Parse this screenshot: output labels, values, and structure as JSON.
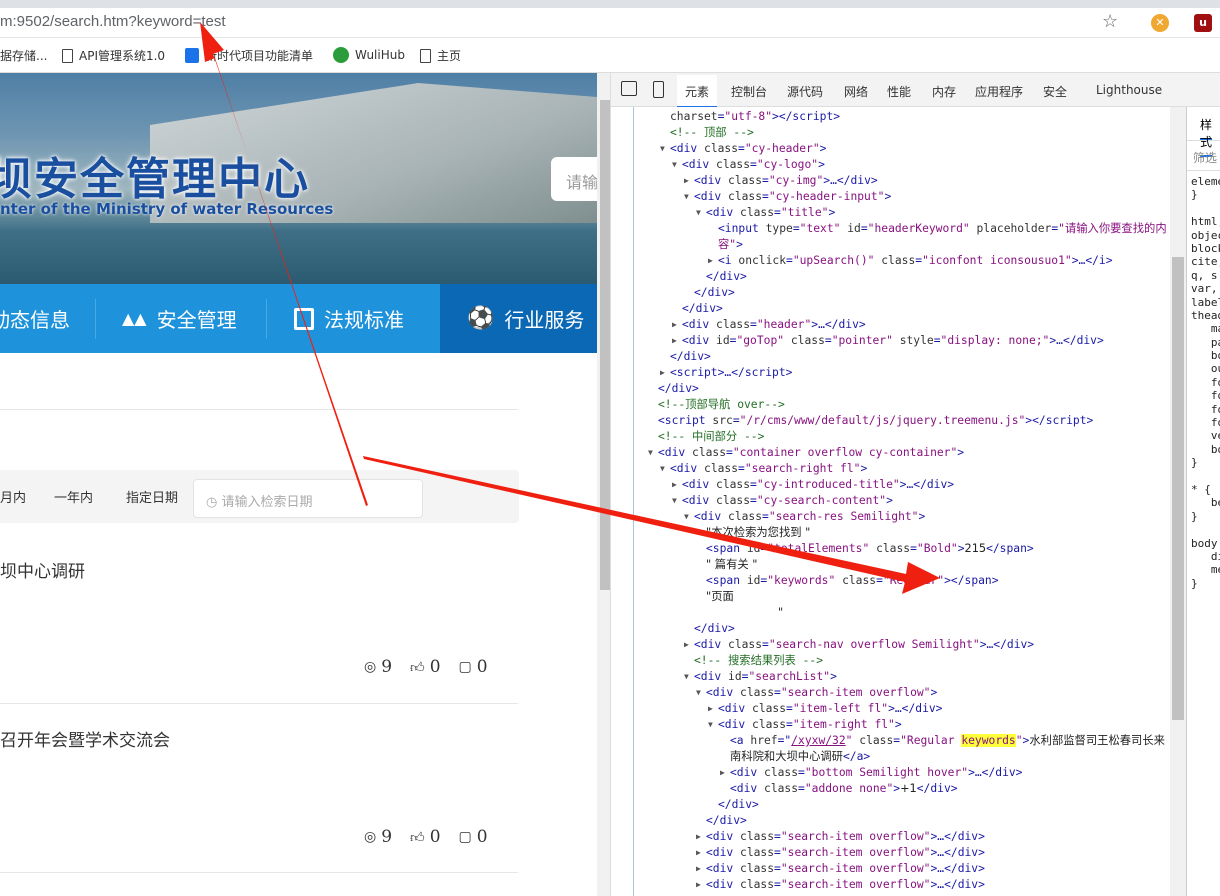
{
  "browser": {
    "url": "m:9502/search.htm?keyword=test",
    "bookmarks": [
      {
        "label": "据存储...",
        "icon": "none"
      },
      {
        "label": "API管理系统1.0",
        "icon": "doc-icon"
      },
      {
        "label": "新时代项目功能清单",
        "icon": "app-icon"
      },
      {
        "label": "WuliHub",
        "icon": "wulihub-icon"
      },
      {
        "label": "主页",
        "icon": "doc-icon"
      }
    ]
  },
  "page": {
    "brand": "坝安全管理中心",
    "brand_sub": "nter of the Ministry of water Resources",
    "header_search_placeholder": "请输",
    "nav": [
      {
        "label": "动态信息"
      },
      {
        "label": "安全管理"
      },
      {
        "label": "法规标准"
      },
      {
        "label": "行业服务"
      }
    ],
    "filters": [
      "月内",
      "一年内",
      "指定日期"
    ],
    "date_placeholder": "请输入检索日期",
    "results": [
      {
        "title": "坝中心调研",
        "views": "9",
        "likes": "0",
        "comments": "0"
      },
      {
        "title": "召开年会暨学术交流会",
        "views": "9",
        "likes": "0",
        "comments": "0"
      }
    ]
  },
  "devtools": {
    "tabs": [
      "元素",
      "控制台",
      "源代码",
      "网络",
      "性能",
      "内存",
      "应用程序",
      "安全",
      "Lighthouse"
    ],
    "active_tab": "元素",
    "lines": [
      {
        "l": 1,
        "s": [
          [
            "a",
            "charset"
          ],
          [
            "t",
            "="
          ],
          [
            "v",
            "\"utf-8\""
          ],
          [
            "t",
            "></script>"
          ]
        ]
      },
      {
        "l": 1,
        "s": [
          [
            "c",
            "<!-- 顶部 -->"
          ]
        ]
      },
      {
        "l": 1,
        "e": "▼",
        "s": [
          [
            "t",
            "<div "
          ],
          [
            "a",
            "class"
          ],
          [
            "t",
            "="
          ],
          [
            "v",
            "\"cy-header\""
          ],
          [
            "t",
            ">"
          ]
        ]
      },
      {
        "l": 2,
        "e": "▼",
        "s": [
          [
            "t",
            "<div "
          ],
          [
            "a",
            "class"
          ],
          [
            "t",
            "="
          ],
          [
            "v",
            "\"cy-logo\""
          ],
          [
            "t",
            ">"
          ]
        ]
      },
      {
        "l": 3,
        "e": "▶",
        "s": [
          [
            "t",
            "<div "
          ],
          [
            "a",
            "class"
          ],
          [
            "t",
            "="
          ],
          [
            "v",
            "\"cy-img\""
          ],
          [
            "t",
            ">…</div>"
          ]
        ]
      },
      {
        "l": 3,
        "e": "▼",
        "s": [
          [
            "t",
            "<div "
          ],
          [
            "a",
            "class"
          ],
          [
            "t",
            "="
          ],
          [
            "v",
            "\"cy-header-input\""
          ],
          [
            "t",
            ">"
          ]
        ]
      },
      {
        "l": 4,
        "e": "▼",
        "s": [
          [
            "t",
            "<div "
          ],
          [
            "a",
            "class"
          ],
          [
            "t",
            "="
          ],
          [
            "v",
            "\"title\""
          ],
          [
            "t",
            ">"
          ]
        ]
      },
      {
        "l": 5,
        "s": [
          [
            "t",
            "<input "
          ],
          [
            "a",
            "type"
          ],
          [
            "t",
            "="
          ],
          [
            "v",
            "\"text\" "
          ],
          [
            "a",
            "id"
          ],
          [
            "t",
            "="
          ],
          [
            "v",
            "\"headerKeyword\" "
          ],
          [
            "a",
            "placeholder"
          ],
          [
            "t",
            "="
          ],
          [
            "v",
            "\"请输入你要查找的内"
          ]
        ]
      },
      {
        "l": 5,
        "s": [
          [
            "v",
            "容\""
          ],
          [
            "t",
            ">"
          ]
        ]
      },
      {
        "l": 5,
        "e": "▶",
        "s": [
          [
            "t",
            "<i "
          ],
          [
            "a",
            "onclick"
          ],
          [
            "t",
            "="
          ],
          [
            "v",
            "\"upSearch()\" "
          ],
          [
            "a",
            "class"
          ],
          [
            "t",
            "="
          ],
          [
            "v",
            "\"iconfont iconsousuo1\""
          ],
          [
            "t",
            ">…</i>"
          ]
        ]
      },
      {
        "l": 4,
        "s": [
          [
            "t",
            "</div>"
          ]
        ]
      },
      {
        "l": 3,
        "s": [
          [
            "t",
            "</div>"
          ]
        ]
      },
      {
        "l": 2,
        "s": [
          [
            "t",
            "</div>"
          ]
        ]
      },
      {
        "l": 2,
        "e": "▶",
        "s": [
          [
            "t",
            "<div "
          ],
          [
            "a",
            "class"
          ],
          [
            "t",
            "="
          ],
          [
            "v",
            "\"header\""
          ],
          [
            "t",
            ">…</div>"
          ]
        ]
      },
      {
        "l": 2,
        "e": "▶",
        "s": [
          [
            "t",
            "<div "
          ],
          [
            "a",
            "id"
          ],
          [
            "t",
            "="
          ],
          [
            "v",
            "\"goTop\" "
          ],
          [
            "a",
            "class"
          ],
          [
            "t",
            "="
          ],
          [
            "v",
            "\"pointer\" "
          ],
          [
            "a",
            "style"
          ],
          [
            "t",
            "="
          ],
          [
            "v",
            "\"display: none;\""
          ],
          [
            "t",
            ">…</div>"
          ]
        ]
      },
      {
        "l": 1,
        "s": [
          [
            "t",
            "</div>"
          ]
        ]
      },
      {
        "l": 1,
        "e": "▶",
        "s": [
          [
            "t",
            "<script>…</script>"
          ]
        ]
      },
      {
        "l": 0,
        "s": [
          [
            "t",
            "</div>"
          ]
        ]
      },
      {
        "l": 0,
        "s": [
          [
            "c",
            "<!--顶部导航 over-->"
          ]
        ]
      },
      {
        "l": 0,
        "s": [
          [
            "t",
            "<script "
          ],
          [
            "a",
            "src"
          ],
          [
            "t",
            "="
          ],
          [
            "v",
            "\"/r/cms/www/default/js/jquery.treemenu.js\""
          ],
          [
            "t",
            "></script>"
          ]
        ]
      },
      {
        "l": 0,
        "s": [
          [
            "c",
            "<!-- 中间部分 -->"
          ]
        ]
      },
      {
        "l": 0,
        "e": "▼",
        "s": [
          [
            "t",
            "<div "
          ],
          [
            "a",
            "class"
          ],
          [
            "t",
            "="
          ],
          [
            "v",
            "\"container overflow cy-container\""
          ],
          [
            "t",
            ">"
          ]
        ]
      },
      {
        "l": 1,
        "e": "▼",
        "s": [
          [
            "t",
            "<div "
          ],
          [
            "a",
            "class"
          ],
          [
            "t",
            "="
          ],
          [
            "v",
            "\"search-right fl\""
          ],
          [
            "t",
            ">"
          ]
        ]
      },
      {
        "l": 2,
        "e": "▶",
        "s": [
          [
            "t",
            "<div "
          ],
          [
            "a",
            "class"
          ],
          [
            "t",
            "="
          ],
          [
            "v",
            "\"cy-introduced-title\""
          ],
          [
            "t",
            ">…</div>"
          ]
        ]
      },
      {
        "l": 2,
        "e": "▼",
        "s": [
          [
            "t",
            "<div "
          ],
          [
            "a",
            "class"
          ],
          [
            "t",
            "="
          ],
          [
            "v",
            "\"cy-search-content\""
          ],
          [
            "t",
            ">"
          ]
        ]
      },
      {
        "l": 3,
        "e": "▼",
        "s": [
          [
            "t",
            "<div "
          ],
          [
            "a",
            "class"
          ],
          [
            "t",
            "="
          ],
          [
            "v",
            "\"search-res Semilight\""
          ],
          [
            "t",
            ">"
          ]
        ]
      },
      {
        "l": 4,
        "s": [
          [
            "x",
            "\"本次检索为您找到 \""
          ]
        ]
      },
      {
        "l": 4,
        "s": [
          [
            "t",
            "<span "
          ],
          [
            "a",
            "id"
          ],
          [
            "t",
            "="
          ],
          [
            "v",
            "\"totalElements\" "
          ],
          [
            "a",
            "class"
          ],
          [
            "t",
            "="
          ],
          [
            "v",
            "\"Bold\""
          ],
          [
            "t",
            ">"
          ],
          [
            "x",
            "215"
          ],
          [
            "t",
            "</span>"
          ]
        ]
      },
      {
        "l": 4,
        "s": [
          [
            "x",
            "\" 篇有关 \""
          ]
        ]
      },
      {
        "l": 4,
        "s": [
          [
            "t",
            "<span "
          ],
          [
            "a",
            "id"
          ],
          [
            "t",
            "="
          ],
          [
            "v",
            "\"keywords\" "
          ],
          [
            "a",
            "class"
          ],
          [
            "t",
            "="
          ],
          [
            "v",
            "\"Regular\""
          ],
          [
            "t",
            "></span>"
          ]
        ]
      },
      {
        "l": 4,
        "s": [
          [
            "x",
            "\"页面"
          ]
        ]
      },
      {
        "l": 10,
        "s": [
          [
            "x",
            "\""
          ]
        ]
      },
      {
        "l": 3,
        "s": [
          [
            "t",
            "</div>"
          ]
        ]
      },
      {
        "l": 3,
        "e": "▶",
        "s": [
          [
            "t",
            "<div "
          ],
          [
            "a",
            "class"
          ],
          [
            "t",
            "="
          ],
          [
            "v",
            "\"search-nav overflow Semilight\""
          ],
          [
            "t",
            ">…</div>"
          ]
        ]
      },
      {
        "l": 3,
        "s": [
          [
            "c",
            "<!-- 搜索结果列表 -->"
          ]
        ]
      },
      {
        "l": 3,
        "e": "▼",
        "s": [
          [
            "t",
            "<div "
          ],
          [
            "a",
            "id"
          ],
          [
            "t",
            "="
          ],
          [
            "v",
            "\"searchList\""
          ],
          [
            "t",
            ">"
          ]
        ]
      },
      {
        "l": 4,
        "e": "▼",
        "s": [
          [
            "t",
            "<div "
          ],
          [
            "a",
            "class"
          ],
          [
            "t",
            "="
          ],
          [
            "v",
            "\"search-item overflow\""
          ],
          [
            "t",
            ">"
          ]
        ]
      },
      {
        "l": 5,
        "e": "▶",
        "s": [
          [
            "t",
            "<div "
          ],
          [
            "a",
            "class"
          ],
          [
            "t",
            "="
          ],
          [
            "v",
            "\"item-left fl\""
          ],
          [
            "t",
            ">…</div>"
          ]
        ]
      },
      {
        "l": 5,
        "e": "▼",
        "s": [
          [
            "t",
            "<div "
          ],
          [
            "a",
            "class"
          ],
          [
            "t",
            "="
          ],
          [
            "v",
            "\"item-right fl\""
          ],
          [
            "t",
            ">"
          ]
        ]
      },
      {
        "l": 6,
        "s": [
          [
            "t",
            "<a "
          ],
          [
            "a",
            "href"
          ],
          [
            "t",
            "=\""
          ],
          [
            "u",
            "/xyxw/32"
          ],
          [
            "v",
            "\" "
          ],
          [
            "a",
            "class"
          ],
          [
            "t",
            "="
          ],
          [
            "v",
            "\"Regular "
          ],
          [
            "h",
            "keywords"
          ],
          [
            "v",
            "\""
          ],
          [
            "t",
            ">"
          ],
          [
            "x",
            "水利部监督司王松春司长来"
          ]
        ]
      },
      {
        "l": 6,
        "s": [
          [
            "x",
            "南科院和大坝中心调研"
          ],
          [
            "t",
            "</a>"
          ]
        ]
      },
      {
        "l": 6,
        "e": "▶",
        "s": [
          [
            "t",
            "<div "
          ],
          [
            "a",
            "class"
          ],
          [
            "t",
            "="
          ],
          [
            "v",
            "\"bottom Semilight hover\""
          ],
          [
            "t",
            ">…</div>"
          ]
        ]
      },
      {
        "l": 6,
        "s": [
          [
            "t",
            "<div "
          ],
          [
            "a",
            "class"
          ],
          [
            "t",
            "="
          ],
          [
            "v",
            "\"addone none\""
          ],
          [
            "t",
            ">"
          ],
          [
            "x",
            "+1"
          ],
          [
            "t",
            "</div>"
          ]
        ]
      },
      {
        "l": 5,
        "s": [
          [
            "t",
            "</div>"
          ]
        ]
      },
      {
        "l": 4,
        "s": [
          [
            "t",
            "</div>"
          ]
        ]
      },
      {
        "l": 4,
        "e": "▶",
        "s": [
          [
            "t",
            "<div "
          ],
          [
            "a",
            "class"
          ],
          [
            "t",
            "="
          ],
          [
            "v",
            "\"search-item overflow\""
          ],
          [
            "t",
            ">…</div>"
          ]
        ]
      },
      {
        "l": 4,
        "e": "▶",
        "s": [
          [
            "t",
            "<div "
          ],
          [
            "a",
            "class"
          ],
          [
            "t",
            "="
          ],
          [
            "v",
            "\"search-item overflow\""
          ],
          [
            "t",
            ">…</div>"
          ]
        ]
      },
      {
        "l": 4,
        "e": "▶",
        "s": [
          [
            "t",
            "<div "
          ],
          [
            "a",
            "class"
          ],
          [
            "t",
            "="
          ],
          [
            "v",
            "\"search-item overflow\""
          ],
          [
            "t",
            ">…</div>"
          ]
        ]
      },
      {
        "l": 4,
        "e": "▶",
        "s": [
          [
            "t",
            "<div "
          ],
          [
            "a",
            "class"
          ],
          [
            "t",
            "="
          ],
          [
            "v",
            "\"search-item overflow\""
          ],
          [
            "t",
            ">…</div>"
          ]
        ]
      }
    ],
    "styles": {
      "tab": "样式",
      "filter": "筛选",
      "lines": [
        "eleme",
        "}",
        "",
        "html,",
        "objec",
        "block",
        "cite,",
        "q, s",
        "var,",
        "label",
        "thead",
        "   ma",
        "   pa",
        "   bo",
        "   ou",
        "   fo",
        "   fo",
        "   fo",
        "   fo",
        "   ve",
        "   bo",
        "}",
        "",
        "* {",
        "   be",
        "}",
        "",
        "body",
        "   di",
        "   me",
        "}"
      ]
    }
  },
  "colors": {
    "nav_blue": "#1e92db",
    "nav_active": "#0a68b4",
    "annotation_red": "#f02010"
  }
}
